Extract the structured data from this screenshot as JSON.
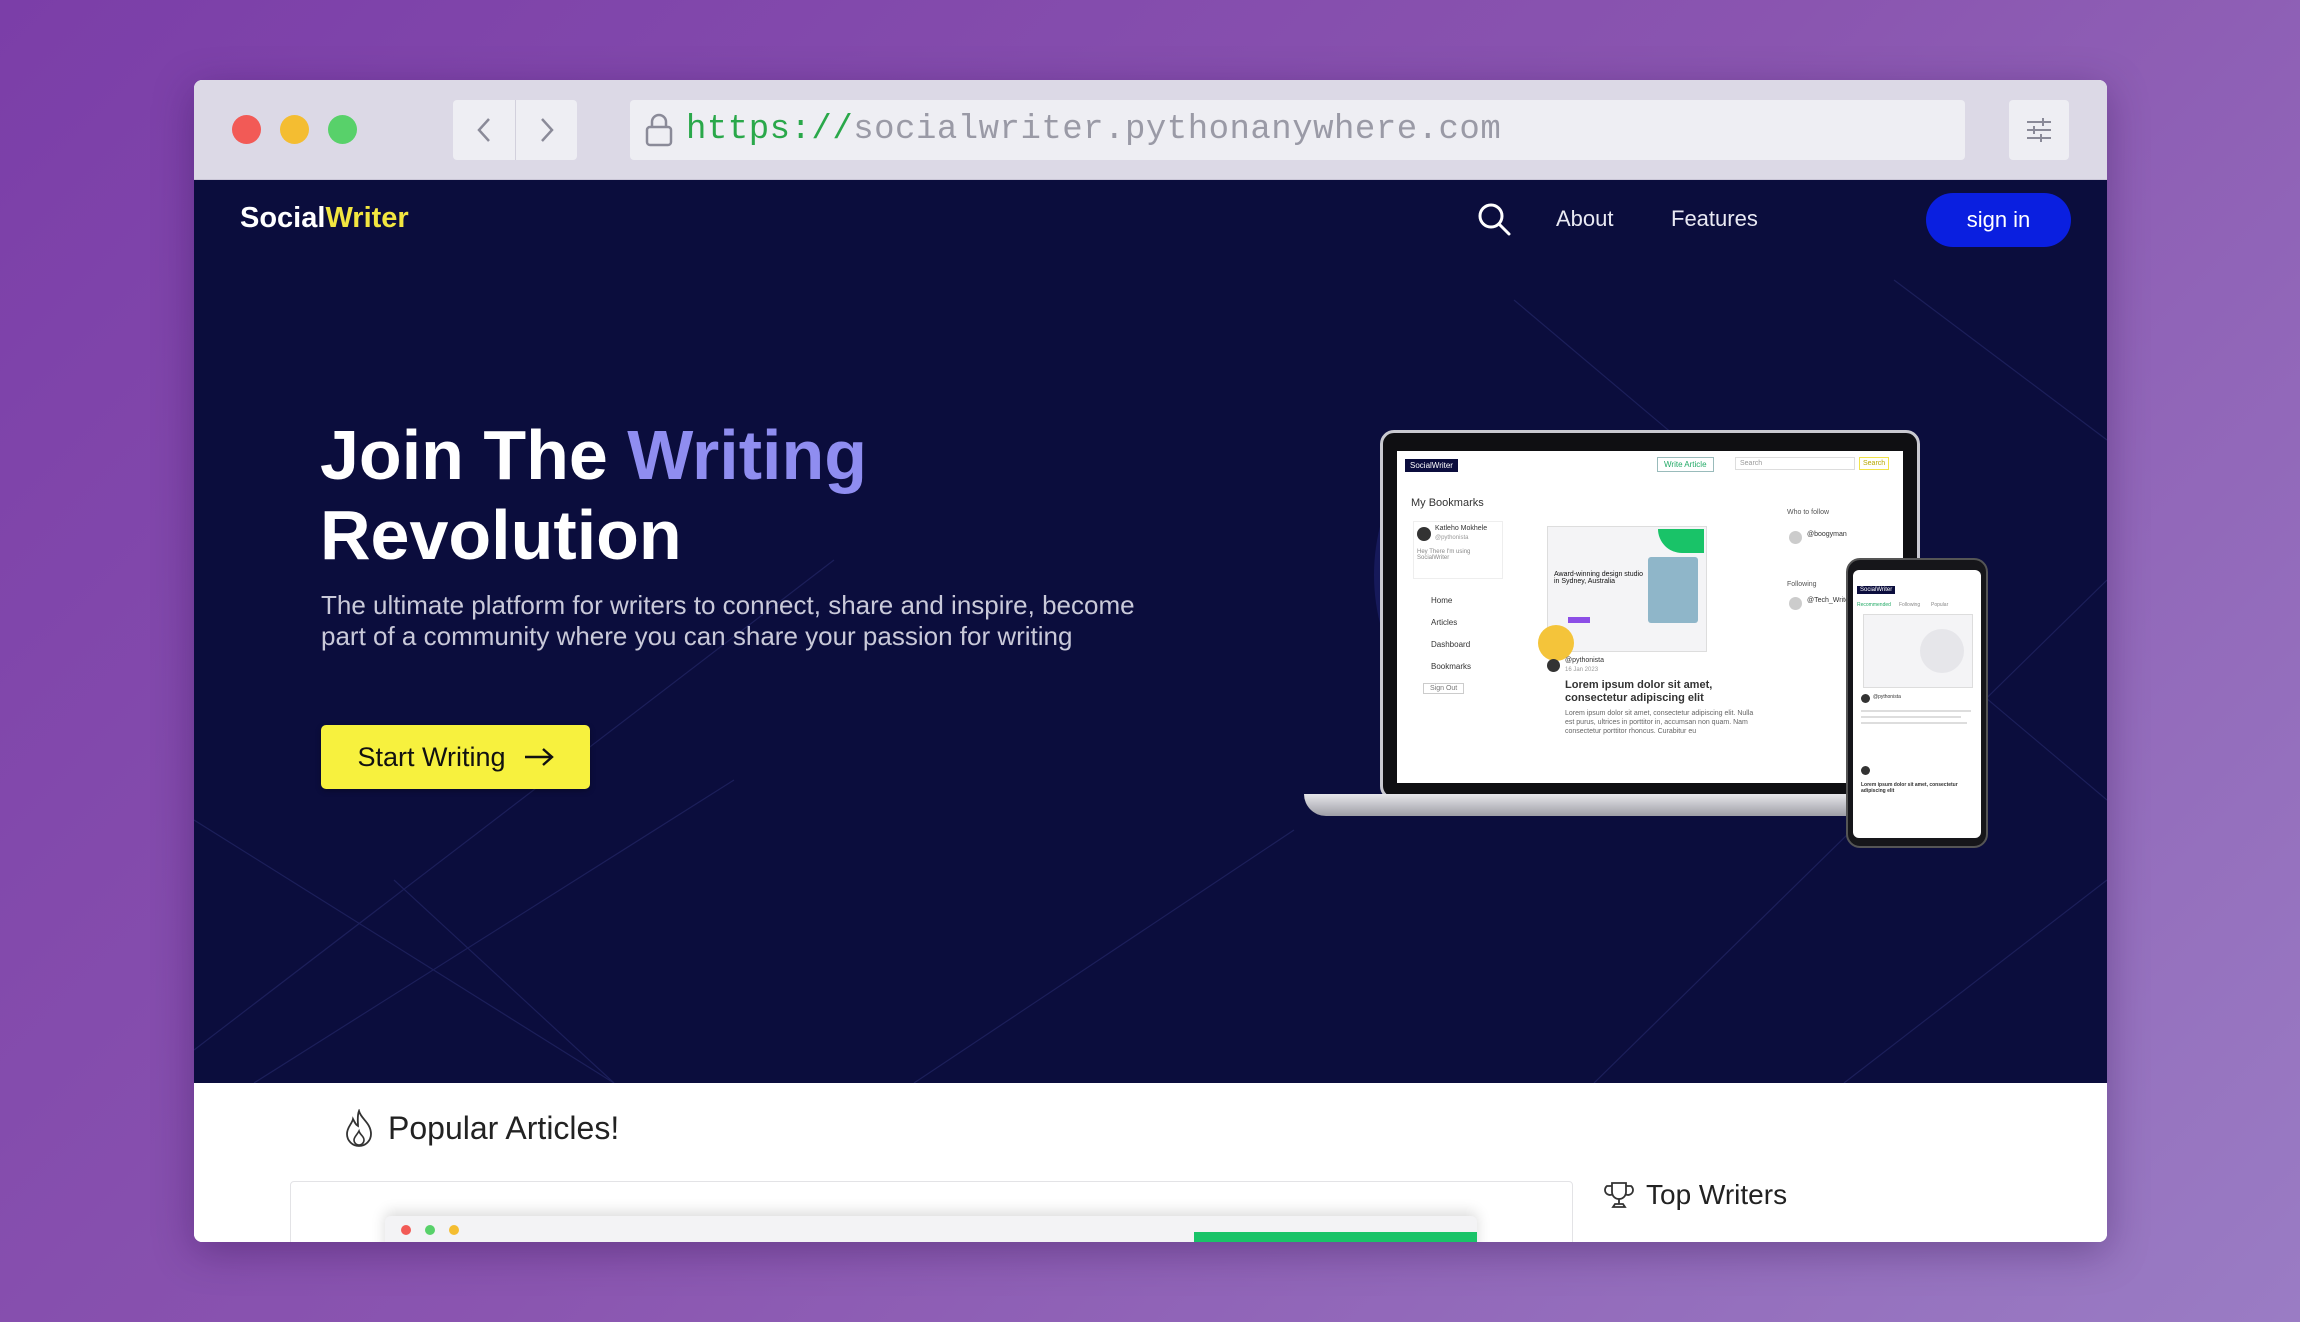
{
  "browser": {
    "url_scheme": "https://",
    "url_host": "socialwriter.pythonanywhere.com"
  },
  "nav": {
    "brand_part1": "Social",
    "brand_part2": "Writer",
    "about": "About",
    "features": "Features",
    "signin": "sign in"
  },
  "hero": {
    "headline_part1": "Join The ",
    "headline_highlight": "Writing",
    "headline_part2": "Revolution",
    "subtext": "The ultimate platform for writers to connect, share and inspire, become part of a community where you can share your passion for writing",
    "cta": "Start Writing"
  },
  "mockup": {
    "brand": "SocialWriter",
    "write_article": "Write Article",
    "search": "Search",
    "search_btn": "Search",
    "bookmarks_title": "My Bookmarks",
    "profile_name": "Katleho Mokhele",
    "profile_handle": "@pythonista",
    "profile_bio": "Hey There I'm using SocialWriter",
    "menu": [
      "Home",
      "Articles",
      "Dashboard",
      "Bookmarks"
    ],
    "signout": "Sign Out",
    "who_to_follow": "Who to follow",
    "follow_user": "@boogyman",
    "following": "Following",
    "following_user": "@Tech_Writers",
    "article_author": "@pythonista",
    "article_date": "16 Jan 2023",
    "article_title": "Lorem ipsum dolor sit amet, consectetur adipiscing elit",
    "article_excerpt": "Lorem ipsum dolor sit amet, consectetur adipiscing elit. Nulla est purus, ultrices in porttitor in, accumsan non quam. Nam consectetur porttitor rhoncus. Curabitur eu",
    "feature_card_title": "Award-winning design studio in Sydney, Australia",
    "phone_tabs": [
      "Recommended",
      "Following",
      "Popular"
    ]
  },
  "lower": {
    "popular_title": "Popular Articles!",
    "top_writers": "Top Writers"
  },
  "colors": {
    "hero_bg": "#0b0d3d",
    "accent_yellow": "#f7f13e",
    "highlight": "#8f8df0",
    "signin_blue": "#0a1fe0"
  }
}
